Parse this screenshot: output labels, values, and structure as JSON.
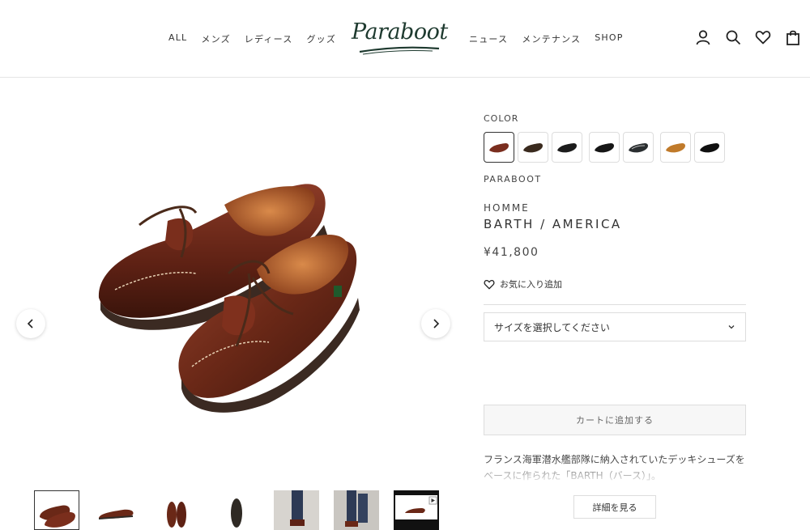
{
  "header": {
    "nav_left": [
      "ALL",
      "メンズ",
      "レディース",
      "グッズ"
    ],
    "nav_right": [
      "ニュース",
      "メンテナンス",
      "SHOP"
    ],
    "logo_text": "Paraboot"
  },
  "product": {
    "color_label": "COLOR",
    "brand": "PARABOOT",
    "category": "HOMME",
    "title": "BARTH / AMERICA",
    "price": "¥41,800",
    "favorite_label": "お気に入り追加",
    "size_placeholder": "サイズを選択してください",
    "add_to_cart": "カートに追加する",
    "description": "フランス海軍潜水艦部隊に納入されていたデッキシューズをベースに作られた「BARTH（バース）」。",
    "read_more": "詳細を見る",
    "swatch_colors": [
      "#7a2e1f",
      "#3a2a1e",
      "#1c1c1c",
      "#161616",
      "#2a2e30",
      "#c07a2a",
      "#101010"
    ]
  },
  "colors": {
    "text": "#333333",
    "border": "#dddddd",
    "logo_green": "#1e3a2f",
    "shoe_brown": "#6e2a1a"
  },
  "icons": [
    "user-icon",
    "search-icon",
    "heart-icon",
    "bag-icon",
    "chevron-left-icon",
    "chevron-right-icon",
    "chevron-down-icon",
    "play-icon"
  ]
}
